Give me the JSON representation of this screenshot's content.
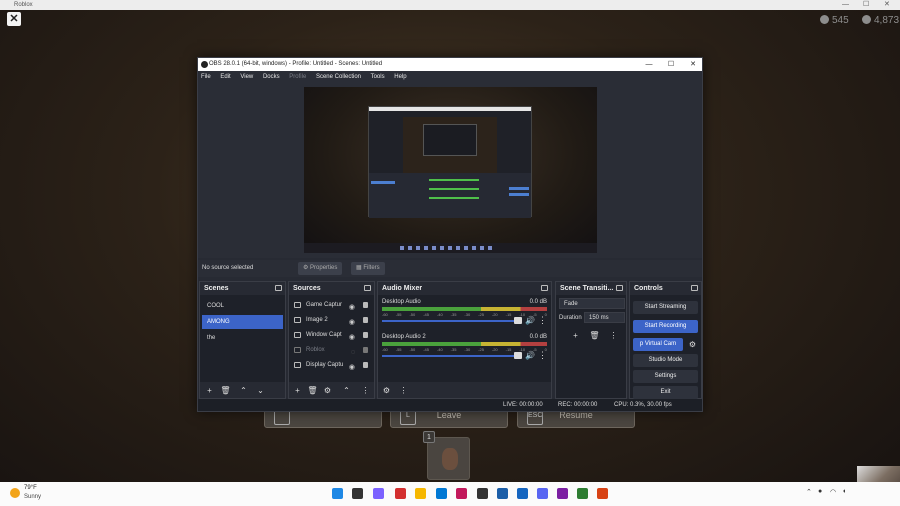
{
  "roblox": {
    "title": "Roblox",
    "stats": [
      {
        "icon": "coin-icon",
        "value": "545"
      },
      {
        "icon": "robux-icon",
        "value": "4,873"
      }
    ],
    "menu_buttons": [
      {
        "key": "",
        "label": ""
      },
      {
        "key": "L",
        "label": "Leave"
      },
      {
        "key": "ESC",
        "label": "Resume"
      }
    ],
    "avatar_index": "1"
  },
  "obs": {
    "title": "OBS 28.0.1 (64-bit, windows) - Profile: Untitled - Scenes: Untitled",
    "menu": [
      "File",
      "Edit",
      "View",
      "Docks",
      "Profile",
      "Scene Collection",
      "Tools",
      "Help"
    ],
    "status_strip": {
      "no_source": "No source selected",
      "properties": "Properties",
      "filters": "Filters"
    },
    "docks": {
      "scenes": {
        "title": "Scenes",
        "items": [
          "COOL",
          "AMONG",
          "the"
        ],
        "active_index": 1
      },
      "sources": {
        "title": "Sources",
        "items": [
          {
            "label": "Game Captur",
            "dim": false
          },
          {
            "label": "Image 2",
            "dim": false
          },
          {
            "label": "Window Capt",
            "dim": false
          },
          {
            "label": "Roblox",
            "dim": true
          },
          {
            "label": "Display Captu",
            "dim": false
          }
        ]
      },
      "mixer": {
        "title": "Audio Mixer",
        "channels": [
          {
            "name": "Desktop Audio",
            "db": "0.0 dB"
          },
          {
            "name": "Desktop Audio 2",
            "db": "0.0 dB"
          }
        ],
        "ticks": [
          "-60",
          "-55",
          "-50",
          "-45",
          "-40",
          "-35",
          "-30",
          "-25",
          "-20",
          "-15",
          "-10",
          "-5",
          "0"
        ]
      },
      "transitions": {
        "title": "Scene Transiti...",
        "type": "Fade",
        "duration_label": "Duration",
        "duration_value": "150 ms"
      },
      "controls": {
        "title": "Controls",
        "buttons": {
          "start_streaming": "Start Streaming",
          "start_recording": "Start Recording",
          "virtual_cam": "p Virtual Cam",
          "studio_mode": "Studio Mode",
          "settings": "Settings",
          "exit": "Exit"
        }
      }
    },
    "statusbar": {
      "live": "LIVE: 00:00:00",
      "rec": "REC: 00:00:00",
      "cpu": "CPU: 0.3%, 30.00 fps"
    }
  },
  "taskbar": {
    "weather_temp": "79°F",
    "weather_cond": "Sunny",
    "app_colors": [
      "#1e88e5",
      "#333333",
      "#7b61ff",
      "#d32f2f",
      "#f6b700",
      "#0078d4",
      "#c2185b",
      "#333333",
      "#1b5ea8",
      "#1565c0",
      "#5865f2",
      "#7b1fa2",
      "#2e7d32",
      "#d84315"
    ]
  },
  "colors": {
    "accent": "#3c64c8",
    "meter_green": "#4aa23c",
    "meter_yellow": "#c7b433",
    "meter_red": "#b44040"
  }
}
